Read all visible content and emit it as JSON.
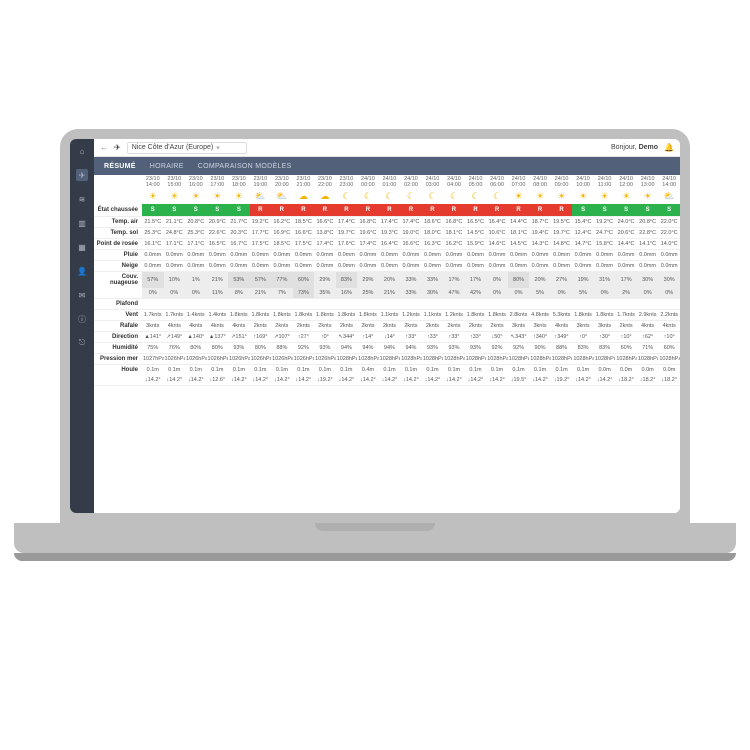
{
  "greeting_prefix": "Bonjour, ",
  "greeting_name": "Demo",
  "location": "Nice Côte d'Azur (Europe)",
  "tabs": {
    "resume": "RÉSUMÉ",
    "horaire": "HORAIRE",
    "comparaison": "COMPARAISON MODÈLES"
  },
  "sidebar_icons": [
    "home",
    "plane",
    "wifi",
    "chart",
    "grid",
    "user",
    "chat",
    "info",
    "logout"
  ],
  "row_labels": {
    "etat": "État chaussée",
    "temp_air": "Temp. air",
    "temp_sol": "Temp. sol",
    "rosee": "Point de rosée",
    "pluie": "Pluie",
    "neige": "Neige",
    "nuage": "Couv. nuageuse",
    "plafond": "Plafond",
    "vent": "Vent",
    "rafale": "Rafale",
    "direction": "Direction",
    "humidite": "Humidité",
    "pression": "Pression mer",
    "houle": "Houle"
  },
  "columns": [
    {
      "d": "23/10",
      "h": "14:00",
      "ic": "☀",
      "etat": "S",
      "ec": "#2bb24c",
      "ta": "21.5°C",
      "ts": "25.3°C",
      "ro": "16.1°C",
      "pl": "0.0mm",
      "ne": "0.0mm",
      "c1": "57%",
      "c2": "0%",
      "ve": "1.7knts",
      "ra": "3knts",
      "di": "▲141°",
      "hu": "75%",
      "pr": "1027hPa",
      "ho": "0.1m",
      "hd": "↓14.2°"
    },
    {
      "d": "23/10",
      "h": "15:00",
      "ic": "☀",
      "etat": "S",
      "ec": "#2bb24c",
      "ta": "21.1°C",
      "ts": "24.8°C",
      "ro": "17.1°C",
      "pl": "0.0mm",
      "ne": "0.0mm",
      "c1": "10%",
      "c2": "0%",
      "ve": "1.7knts",
      "ra": "4knts",
      "di": "↗149°",
      "hu": "76%",
      "pr": "1026hPa",
      "ho": "0.1m",
      "hd": "↓14.2°"
    },
    {
      "d": "23/10",
      "h": "16:00",
      "ic": "☀",
      "etat": "S",
      "ec": "#2bb24c",
      "ta": "20.8°C",
      "ts": "25.3°C",
      "ro": "17.1°C",
      "pl": "0.0mm",
      "ne": "0.0mm",
      "c1": "1%",
      "c2": "0%",
      "ve": "1.4knts",
      "ra": "4knts",
      "di": "▲140°",
      "hu": "80%",
      "pr": "1026hPa",
      "ho": "0.1m",
      "hd": "↓14.2°"
    },
    {
      "d": "23/10",
      "h": "17:00",
      "ic": "☀",
      "etat": "S",
      "ec": "#2bb24c",
      "ta": "20.9°C",
      "ts": "22.6°C",
      "ro": "16.5°C",
      "pl": "0.0mm",
      "ne": "0.0mm",
      "c1": "21%",
      "c2": "11%",
      "ve": "1.4knts",
      "ra": "4knts",
      "di": "▲137°",
      "hu": "80%",
      "pr": "1026hPa",
      "ho": "0.1m",
      "hd": "↓12.6°"
    },
    {
      "d": "23/10",
      "h": "18:00",
      "ic": "☀",
      "etat": "S",
      "ec": "#2bb24c",
      "ta": "21.7°C",
      "ts": "20.3°C",
      "ro": "16.7°C",
      "pl": "0.0mm",
      "ne": "0.0mm",
      "c1": "53%",
      "c2": "8%",
      "ve": "1.8knts",
      "ra": "4knts",
      "di": "↗151°",
      "hu": "93%",
      "pr": "1026hPa",
      "ho": "0.1m",
      "hd": "↓14.2°"
    },
    {
      "d": "23/10",
      "h": "19:00",
      "ic": "⛅",
      "etat": "R",
      "ec": "#e53b2e",
      "ta": "19.2°C",
      "ts": "17.7°C",
      "ro": "17.5°C",
      "pl": "0.0mm",
      "ne": "0.0mm",
      "c1": "57%",
      "c2": "21%",
      "ve": "1.8knts",
      "ra": "2knts",
      "di": "↑169°",
      "hu": "80%",
      "pr": "1026hPa",
      "ho": "0.1m",
      "hd": "↓14.2°"
    },
    {
      "d": "23/10",
      "h": "20:00",
      "ic": "⛅",
      "etat": "R",
      "ec": "#e53b2e",
      "ta": "16.2°C",
      "ts": "16.9°C",
      "ro": "18.5°C",
      "pl": "0.0mm",
      "ne": "0.0mm",
      "c1": "77%",
      "c2": "7%",
      "ve": "1.8knts",
      "ra": "2knts",
      "di": "↗107°",
      "hu": "88%",
      "pr": "1026hPa",
      "ho": "0.1m",
      "hd": "↓14.2°"
    },
    {
      "d": "23/10",
      "h": "21:00",
      "ic": "☁",
      "etat": "R",
      "ec": "#e53b2e",
      "ta": "18.5°C",
      "ts": "16.6°C",
      "ro": "17.5°C",
      "pl": "0.0mm",
      "ne": "0.0mm",
      "c1": "60%",
      "c2": "73%",
      "ve": "1.8knts",
      "ra": "2knts",
      "di": "↑27°",
      "hu": "92%",
      "pr": "1026hPa",
      "ho": "0.1m",
      "hd": "↓14.2°"
    },
    {
      "d": "23/10",
      "h": "22:00",
      "ic": "☁",
      "etat": "R",
      "ec": "#e53b2e",
      "ta": "16.6°C",
      "ts": "13.8°C",
      "ro": "17.4°C",
      "pl": "0.0mm",
      "ne": "0.0mm",
      "c1": "29%",
      "c2": "35%",
      "ve": "1.8knts",
      "ra": "2knts",
      "di": "↑0°",
      "hu": "93%",
      "pr": "1026hPa",
      "ho": "0.1m",
      "hd": "↓19.2°"
    },
    {
      "d": "23/10",
      "h": "23:00",
      "ic": "☾",
      "etat": "R",
      "ec": "#e53b2e",
      "ta": "17.4°C",
      "ts": "19.7°C",
      "ro": "17.6°C",
      "pl": "0.0mm",
      "ne": "0.0mm",
      "c1": "83%",
      "c2": "16%",
      "ve": "1.8knts",
      "ra": "2knts",
      "di": "↖344°",
      "hu": "94%",
      "pr": "1028hPa",
      "ho": "0.1m",
      "hd": "↓14.2°"
    },
    {
      "d": "24/10",
      "h": "00:00",
      "ic": "☾",
      "etat": "R",
      "ec": "#e53b2e",
      "ta": "16.8°C",
      "ts": "19.6°C",
      "ro": "17.4°C",
      "pl": "0.0mm",
      "ne": "0.0mm",
      "c1": "29%",
      "c2": "25%",
      "ve": "1.8knts",
      "ra": "2knts",
      "di": "↑14°",
      "hu": "94%",
      "pr": "1028hPa",
      "ho": "0.4m",
      "hd": "↓14.2°"
    },
    {
      "d": "24/10",
      "h": "01:00",
      "ic": "☾",
      "etat": "R",
      "ec": "#e53b2e",
      "ta": "17.4°C",
      "ts": "19.3°C",
      "ro": "16.4°C",
      "pl": "0.0mm",
      "ne": "0.0mm",
      "c1": "20%",
      "c2": "21%",
      "ve": "1.1knts",
      "ra": "2knts",
      "di": "↓14°",
      "hu": "94%",
      "pr": "1028hPa",
      "ho": "0.1m",
      "hd": "↓14.2°"
    },
    {
      "d": "24/10",
      "h": "02:00",
      "ic": "☾",
      "etat": "R",
      "ec": "#e53b2e",
      "ta": "17.4°C",
      "ts": "19.0°C",
      "ro": "16.6°C",
      "pl": "0.0mm",
      "ne": "0.0mm",
      "c1": "33%",
      "c2": "33%",
      "ve": "1.2knts",
      "ra": "2knts",
      "di": "↑33°",
      "hu": "94%",
      "pr": "1028hPa",
      "ho": "0.1m",
      "hd": "↓14.2°"
    },
    {
      "d": "24/10",
      "h": "03:00",
      "ic": "☾",
      "etat": "R",
      "ec": "#e53b2e",
      "ta": "18.6°C",
      "ts": "18.0°C",
      "ro": "16.3°C",
      "pl": "0.0mm",
      "ne": "0.0mm",
      "c1": "33%",
      "c2": "30%",
      "ve": "1.1knts",
      "ra": "2knts",
      "di": "↑33°",
      "hu": "93%",
      "pr": "1028hPa",
      "ho": "0.1m",
      "hd": "↓14.2°"
    },
    {
      "d": "24/10",
      "h": "04:00",
      "ic": "☾",
      "etat": "R",
      "ec": "#e53b2e",
      "ta": "16.8°C",
      "ts": "18.1°C",
      "ro": "16.2°C",
      "pl": "0.0mm",
      "ne": "0.0mm",
      "c1": "17%",
      "c2": "47%",
      "ve": "1.2knts",
      "ra": "2knts",
      "di": "↑33°",
      "hu": "93%",
      "pr": "1028hPa",
      "ho": "0.1m",
      "hd": "↓14.2°"
    },
    {
      "d": "24/10",
      "h": "05:00",
      "ic": "☾",
      "etat": "R",
      "ec": "#e53b2e",
      "ta": "16.5°C",
      "ts": "14.5°C",
      "ro": "15.9°C",
      "pl": "0.0mm",
      "ne": "0.0mm",
      "c1": "17%",
      "c2": "42%",
      "ve": "1.8knts",
      "ra": "2knts",
      "di": "↑33°",
      "hu": "93%",
      "pr": "1028hPa",
      "ho": "0.1m",
      "hd": "↓14.2°"
    },
    {
      "d": "24/10",
      "h": "06:00",
      "ic": "☾",
      "etat": "R",
      "ec": "#e53b2e",
      "ta": "16.4°C",
      "ts": "10.6°C",
      "ro": "14.6°C",
      "pl": "0.0mm",
      "ne": "0.0mm",
      "c1": "0%",
      "c2": "0%",
      "ve": "1.8knts",
      "ra": "2knts",
      "di": "↓50°",
      "hu": "92%",
      "pr": "1028hPa",
      "ho": "0.1m",
      "hd": "↓14.2°"
    },
    {
      "d": "24/10",
      "h": "07:00",
      "ic": "☀",
      "etat": "R",
      "ec": "#e53b2e",
      "ta": "14.4°C",
      "ts": "18.1°C",
      "ro": "14.5°C",
      "pl": "0.0mm",
      "ne": "0.0mm",
      "c1": "80%",
      "c2": "0%",
      "ve": "2.8knts",
      "ra": "3knts",
      "di": "↖343°",
      "hu": "92%",
      "pr": "1028hPa",
      "ho": "0.1m",
      "hd": "↓19.5°"
    },
    {
      "d": "24/10",
      "h": "08:00",
      "ic": "☀",
      "etat": "R",
      "ec": "#e53b2e",
      "ta": "18.7°C",
      "ts": "19.4°C",
      "ro": "14.3°C",
      "pl": "0.0mm",
      "ne": "0.0mm",
      "c1": "20%",
      "c2": "5%",
      "ve": "4.8knts",
      "ra": "3knts",
      "di": "↑340°",
      "hu": "90%",
      "pr": "1028hPa",
      "ho": "0.1m",
      "hd": "↓14.2°"
    },
    {
      "d": "24/10",
      "h": "09:00",
      "ic": "☀",
      "etat": "R",
      "ec": "#e53b2e",
      "ta": "19.5°C",
      "ts": "19.7°C",
      "ro": "14.8°C",
      "pl": "0.0mm",
      "ne": "0.0mm",
      "c1": "27%",
      "c2": "0%",
      "ve": "5.3knts",
      "ra": "4knts",
      "di": "↑349°",
      "hu": "88%",
      "pr": "1028hPa",
      "ho": "0.1m",
      "hd": "↓19.2°"
    },
    {
      "d": "24/10",
      "h": "10:00",
      "ic": "☀",
      "etat": "S",
      "ec": "#2bb24c",
      "ta": "15.4°C",
      "ts": "12.4°C",
      "ro": "14.7°C",
      "pl": "0.0mm",
      "ne": "0.0mm",
      "c1": "19%",
      "c2": "5%",
      "ve": "1.8knts",
      "ra": "3knts",
      "di": "↑0°",
      "hu": "83%",
      "pr": "1028hPa",
      "ho": "0.1m",
      "hd": "↓14.2°"
    },
    {
      "d": "24/10",
      "h": "11:00",
      "ic": "☀",
      "etat": "S",
      "ec": "#2bb24c",
      "ta": "19.2°C",
      "ts": "24.7°C",
      "ro": "15.8°C",
      "pl": "0.0mm",
      "ne": "0.0mm",
      "c1": "31%",
      "c2": "0%",
      "ve": "1.8knts",
      "ra": "3knts",
      "di": "↑30°",
      "hu": "83%",
      "pr": "1028hPa",
      "ho": "0.0m",
      "hd": "↓14.2°"
    },
    {
      "d": "24/10",
      "h": "12:00",
      "ic": "☀",
      "etat": "S",
      "ec": "#2bb24c",
      "ta": "24.0°C",
      "ts": "20.6°C",
      "ro": "14.4°C",
      "pl": "0.0mm",
      "ne": "0.0mm",
      "c1": "17%",
      "c2": "2%",
      "ve": "1.7knts",
      "ra": "2knts",
      "di": "↑10°",
      "hu": "60%",
      "pr": "1028hPa",
      "ho": "0.0m",
      "hd": "↓18.2°"
    },
    {
      "d": "24/10",
      "h": "13:00",
      "ic": "☀",
      "etat": "S",
      "ec": "#2bb24c",
      "ta": "20.8°C",
      "ts": "22.8°C",
      "ro": "14.1°C",
      "pl": "0.0mm",
      "ne": "0.0mm",
      "c1": "30%",
      "c2": "0%",
      "ve": "2.9knts",
      "ra": "4knts",
      "di": "↑62°",
      "hu": "71%",
      "pr": "1028hPa",
      "ho": "0.0m",
      "hd": "↓18.2°"
    },
    {
      "d": "24/10",
      "h": "14:00",
      "ic": "⛅",
      "etat": "S",
      "ec": "#2bb24c",
      "ta": "22.0°C",
      "ts": "22.0°C",
      "ro": "14.0°C",
      "pl": "0.0mm",
      "ne": "0.0mm",
      "c1": "30%",
      "c2": "0%",
      "ve": "2.2knts",
      "ra": "4knts",
      "di": "↑10°",
      "hu": "60%",
      "pr": "1028hPa",
      "ho": "0.0m",
      "hd": "↓18.2°"
    }
  ]
}
